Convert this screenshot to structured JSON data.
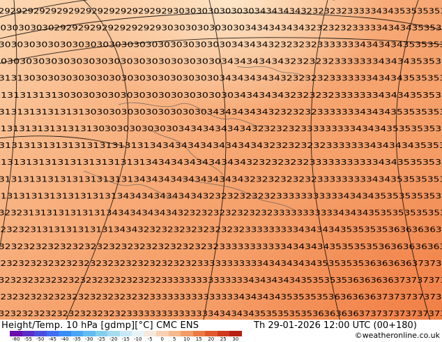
{
  "map": {
    "field_rows": [
      "292929292929292929292929292929303030303030303434343432323232333334343535353535",
      "3030303030292929292929292929303030303030303434343434323232323333343434353535",
      "30303030303030303030303030303030303030343434323232323333333434343435353535",
      "303030303030303030303030303030303030343434343432323232333333343434353535",
      "31313030303030303030303030303030303034343434343232323233333334343435353535",
      "313131313130303030303030303030303030303434343432323232333333343434353535",
      "31313131313131303030303030303030303434343434323232323333333434343535353535",
      "31313131313131313030303030303034343434343432323232333333333434343535353535",
      "313131313131313131313131343434343434343434323232323233333334343434353535",
      "313131313131313131313131343434343434343432323232323333333333343435353535",
      "31313131313131313131313434343434343434343232323232323333333334343535353535",
      "31313131313131313131343434343434343232323232323333333333343434353535353535",
      "3232313131313131313434343434343232323232323232333333333334343435353535353535",
      "3232323131313131313134343232323232323232323333333334343434353535353636363636",
      "32323232323232323232323232323232323233333333333434343435353535363636363636",
      "3232323232323232323232323232323232333333333334343434343535353536363636373737",
      "323232323232323232323232323233333333333333343434343435353535363636363737373737",
      "3232323232323232323232323233333333333333343434343535353536363636373737373737",
      "323232323232323232323233333333333333343434343535353535363636363737373737373737"
    ]
  },
  "footer": {
    "title": "Height/Temp. 10 hPa [gdmp][°C] CMC ENS",
    "datetime": "Th 29-01-2026 12:00 UTC (00+180)",
    "credit": "©weatheronline.co.uk",
    "colorbar": {
      "labels": [
        "-80",
        "-55",
        "-50",
        "-45",
        "-40",
        "-35",
        "-30",
        "-25",
        "-20",
        "-15",
        "-10",
        "-5",
        "0",
        "5",
        "10",
        "15",
        "20",
        "25",
        "30"
      ],
      "colors": [
        "#6a0dad",
        "#5a2ec8",
        "#4b4fe0",
        "#3f6ff0",
        "#3a8cf5",
        "#4aa6f5",
        "#63bcf0",
        "#84cfee",
        "#a6dcf0",
        "#c8e9f5",
        "#e6f3f8",
        "#f5e8dc",
        "#f8d2b4",
        "#f6b98c",
        "#f29c66",
        "#ea7b45",
        "#df5a2c",
        "#cf3a1c",
        "#b81e12"
      ]
    }
  }
}
